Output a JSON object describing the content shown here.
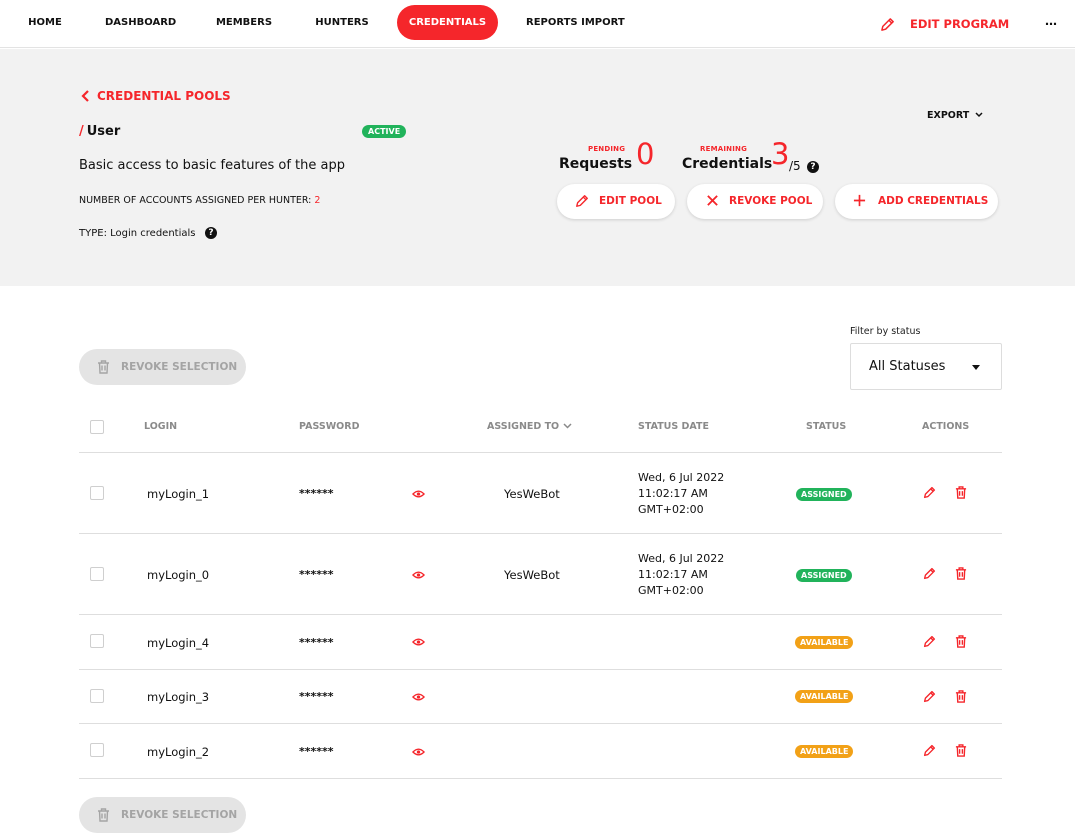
{
  "nav": {
    "items": [
      {
        "label": "HOME",
        "active": false
      },
      {
        "label": "DASHBOARD",
        "active": false
      },
      {
        "label": "MEMBERS",
        "active": false
      },
      {
        "label": "HUNTERS",
        "active": false
      },
      {
        "label": "CREDENTIALS",
        "active": true
      },
      {
        "label": "REPORTS IMPORT",
        "active": false
      }
    ],
    "edit_program_label": "EDIT PROGRAM",
    "more_label": "⋯"
  },
  "colors": {
    "accent": "#f5262b",
    "assigned": "#21b35b",
    "available": "#f2a117",
    "band": "#f2f2f2"
  },
  "header": {
    "back_label": "CREDENTIAL POOLS",
    "slash": "/",
    "pool_name": "User",
    "status_badge": "ACTIVE",
    "description": "Basic access to basic features of the app",
    "accounts_label": "NUMBER OF ACCOUNTS ASSIGNED PER HUNTER:",
    "accounts_value": "2",
    "type_label": "TYPE:",
    "type_value": "Login credentials",
    "help_glyph": "?",
    "export_label": "EXPORT"
  },
  "stats": {
    "pending_small": "PENDING",
    "pending_label": "Requests",
    "pending_value": "0",
    "remaining_small": "REMAINING",
    "remaining_label": "Credentials",
    "remaining_value": "3",
    "remaining_total": "/5"
  },
  "actions": {
    "edit_pool": "EDIT POOL",
    "revoke_pool": "REVOKE POOL",
    "add_credentials": "ADD CREDENTIALS",
    "revoke_selection": "REVOKE SELECTION"
  },
  "filter": {
    "label": "Filter by status",
    "value": "All Statuses"
  },
  "table": {
    "columns": {
      "login": "LOGIN",
      "password": "PASSWORD",
      "assigned_to": "ASSIGNED TO",
      "status_date": "STATUS DATE",
      "status": "STATUS",
      "actions": "ACTIONS"
    },
    "rows": [
      {
        "login": "myLogin_1",
        "password": "******",
        "assigned_to": "YesWeBot",
        "date_line1": "Wed, 6 Jul 2022",
        "date_line2": "11:02:17 AM",
        "date_line3": "GMT+02:00",
        "status": "ASSIGNED"
      },
      {
        "login": "myLogin_0",
        "password": "******",
        "assigned_to": "YesWeBot",
        "date_line1": "Wed, 6 Jul 2022",
        "date_line2": "11:02:17 AM",
        "date_line3": "GMT+02:00",
        "status": "ASSIGNED"
      },
      {
        "login": "myLogin_4",
        "password": "******",
        "assigned_to": "",
        "date_line1": "",
        "date_line2": "",
        "date_line3": "",
        "status": "AVAILABLE"
      },
      {
        "login": "myLogin_3",
        "password": "******",
        "assigned_to": "",
        "date_line1": "",
        "date_line2": "",
        "date_line3": "",
        "status": "AVAILABLE"
      },
      {
        "login": "myLogin_2",
        "password": "******",
        "assigned_to": "",
        "date_line1": "",
        "date_line2": "",
        "date_line3": "",
        "status": "AVAILABLE"
      }
    ]
  }
}
